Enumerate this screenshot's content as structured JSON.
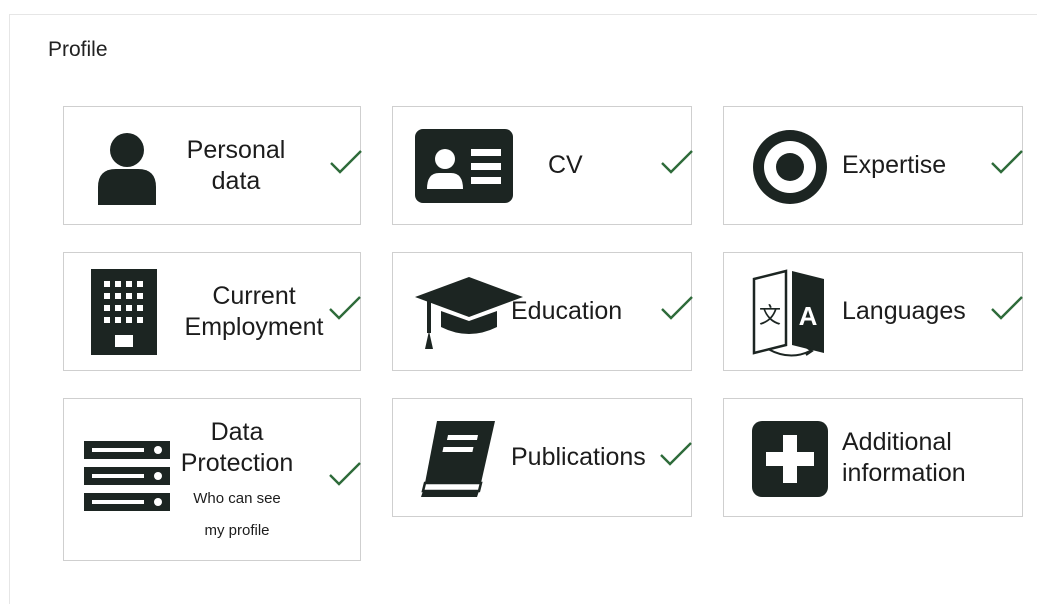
{
  "page": {
    "title": "Profile"
  },
  "colors": {
    "icon": "#1c2522",
    "check": "#2e6b3a",
    "border": "#cfcfcf"
  },
  "cards": [
    {
      "id": "personal-data",
      "icon": "person-icon",
      "label_lines": [
        "Personal",
        "data"
      ],
      "completed": true
    },
    {
      "id": "cv",
      "icon": "id-card-icon",
      "label_lines": [
        "CV"
      ],
      "completed": true
    },
    {
      "id": "expertise",
      "icon": "target-icon",
      "label_lines": [
        "Expertise"
      ],
      "completed": true
    },
    {
      "id": "current-employment",
      "icon": "office-building-icon",
      "label_lines": [
        "Current",
        "Employment"
      ],
      "completed": true
    },
    {
      "id": "education",
      "icon": "graduation-cap-icon",
      "label_lines": [
        "Education"
      ],
      "completed": true
    },
    {
      "id": "languages",
      "icon": "translate-icon",
      "label_lines": [
        "Languages"
      ],
      "completed": true
    },
    {
      "id": "data-protection",
      "icon": "server-stack-icon",
      "label_lines": [
        "Data",
        "Protection"
      ],
      "sublabel_lines": [
        "Who can see",
        "my profile"
      ],
      "completed": true
    },
    {
      "id": "publications",
      "icon": "book-icon",
      "label_lines": [
        "Publications"
      ],
      "completed": true
    },
    {
      "id": "additional-information",
      "icon": "plus-box-icon",
      "label_lines": [
        "Additional",
        "information"
      ],
      "completed": false
    }
  ]
}
